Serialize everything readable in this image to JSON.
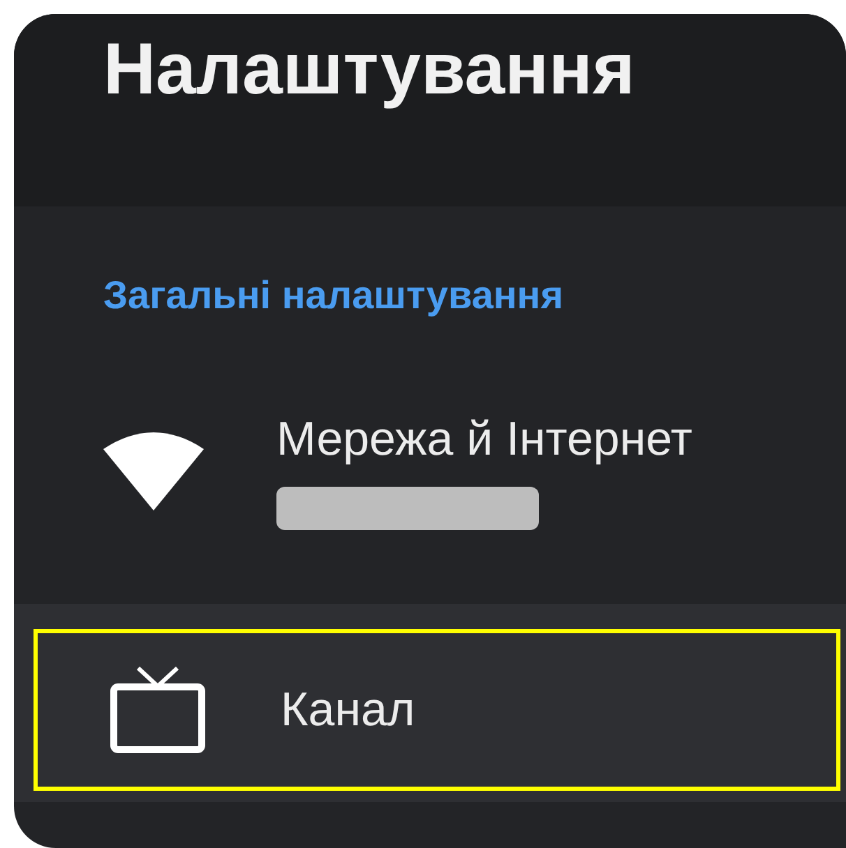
{
  "header": {
    "title": "Налаштування"
  },
  "section": {
    "label": "Загальні налаштування"
  },
  "items": [
    {
      "kind": "wifi",
      "label": "Мережа й Інтернет",
      "redacted_subtitle": true,
      "selected": false
    },
    {
      "kind": "tv",
      "label": "Канал",
      "redacted_subtitle": false,
      "selected": true
    }
  ]
}
